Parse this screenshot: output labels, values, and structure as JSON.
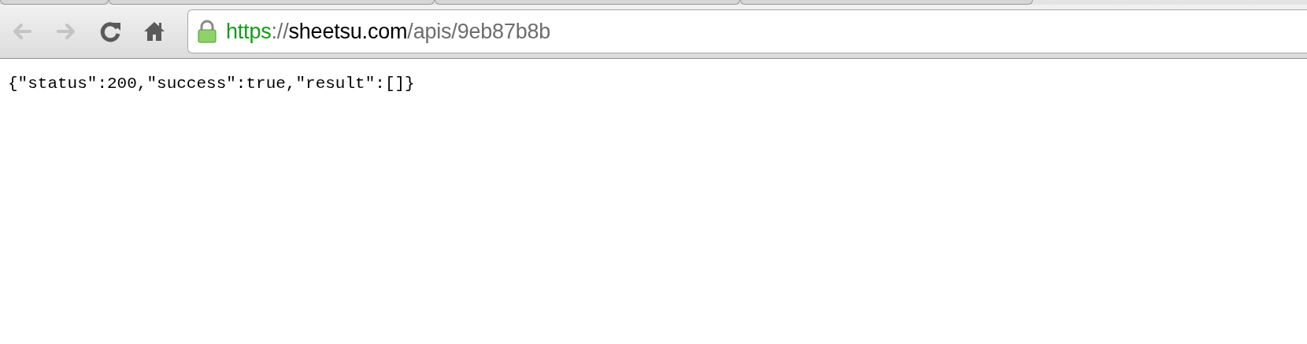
{
  "toolbar": {
    "buttons": [
      {
        "kind": "back",
        "disabled": true
      },
      {
        "kind": "forward",
        "disabled": true
      },
      {
        "kind": "reload",
        "disabled": false
      },
      {
        "kind": "home",
        "disabled": false
      }
    ]
  },
  "address_bar": {
    "secure": true,
    "scheme": "https",
    "separator": "://",
    "host": "sheetsu.com",
    "path": "/apis/9eb87b8b"
  },
  "page": {
    "body_text": "{\"status\":200,\"success\":true,\"result\":[]}"
  }
}
